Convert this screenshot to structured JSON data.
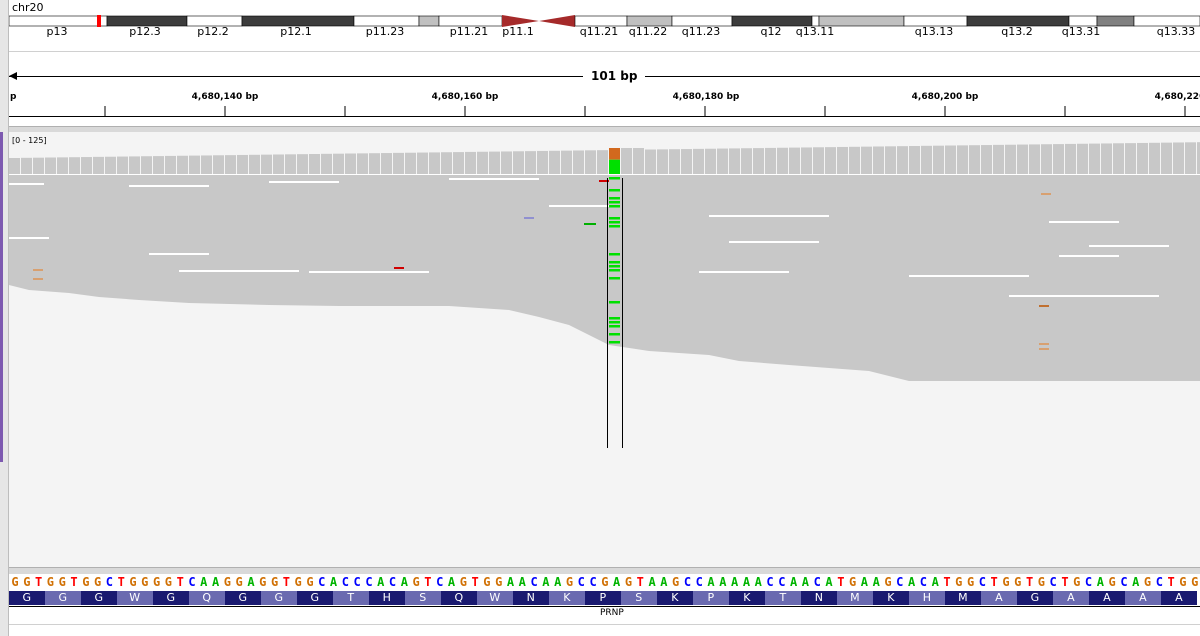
{
  "chromosome": "chr20",
  "ideogram": {
    "bands": [
      {
        "name": "p13",
        "color": "#ffffff"
      },
      {
        "name": "p12.3",
        "color": "#3c3c3c"
      },
      {
        "name": "p12.2",
        "color": "#ffffff"
      },
      {
        "name": "p12.1",
        "color": "#3c3c3c"
      },
      {
        "name": "p11.23",
        "color": "#ffffff"
      },
      {
        "name": "p11.22",
        "color": "#c0c0c0"
      },
      {
        "name": "p11.21",
        "color": "#ffffff"
      },
      {
        "name": "p11.1",
        "color": "#a52a2a"
      },
      {
        "name": "q11.1",
        "color": "#a52a2a"
      },
      {
        "name": "q11.21",
        "color": "#ffffff"
      },
      {
        "name": "q11.22",
        "color": "#c0c0c0"
      },
      {
        "name": "q11.23",
        "color": "#ffffff"
      },
      {
        "name": "q12",
        "color": "#3c3c3c"
      },
      {
        "name": "q13.11",
        "color": "#ffffff"
      },
      {
        "name": "q13.12",
        "color": "#c0c0c0"
      },
      {
        "name": "q13.13",
        "color": "#ffffff"
      },
      {
        "name": "q13.2",
        "color": "#3c3c3c"
      },
      {
        "name": "q13.31",
        "color": "#ffffff"
      },
      {
        "name": "q13.32",
        "color": "#808080"
      },
      {
        "name": "q13.33",
        "color": "#ffffff"
      }
    ],
    "band_labels": [
      "p13",
      "p12.3",
      "p12.2",
      "p12.1",
      "p11.23",
      "p11.21",
      "p11.1",
      "q11.21",
      "q11.22",
      "q11.23",
      "q12",
      "q13.11",
      "q13.13",
      "q13.2",
      "q13.31",
      "q13.33"
    ],
    "current_view_color": "#ff0000"
  },
  "span_label": "101 bp",
  "ruler": {
    "start_label": "p",
    "ticks": [
      "4,680,140 bp",
      "4,680,160 bp",
      "4,680,180 bp",
      "4,680,200 bp",
      "4,680,220"
    ]
  },
  "coverage": {
    "range_label": "[0 - 125]",
    "bar_color": "#c8c8c8",
    "snp_colors": {
      "ref": "#00e000",
      "alt": "#d2691e"
    }
  },
  "alignments": {
    "read_color": "#c8c8c8",
    "mismatch_color": "#00e000"
  },
  "reference_sequence": "GGTGGTGGCTGGGGTCAAGGAGGTGGCACCCACAGTCAGTGGAACAAGCCGAGTAAGCCAAAAACCAACATGAAGCACATGGCTGGTGCTGCAGCAGCTGG",
  "base_colors": {
    "A": "#00b400",
    "C": "#0000ff",
    "G": "#d17105",
    "T": "#ff0000"
  },
  "amino_acids": [
    "G",
    "G",
    "G",
    "W",
    "G",
    "Q",
    "G",
    "G",
    "G",
    "T",
    "H",
    "S",
    "Q",
    "W",
    "N",
    "K",
    "P",
    "S",
    "K",
    "P",
    "K",
    "T",
    "N",
    "M",
    "K",
    "H",
    "M",
    "A",
    "G",
    "A",
    "A",
    "A",
    "A"
  ],
  "aa_colors": [
    "#1a1a70",
    "#6a6ab0"
  ],
  "gene": {
    "name": "PRNP"
  }
}
